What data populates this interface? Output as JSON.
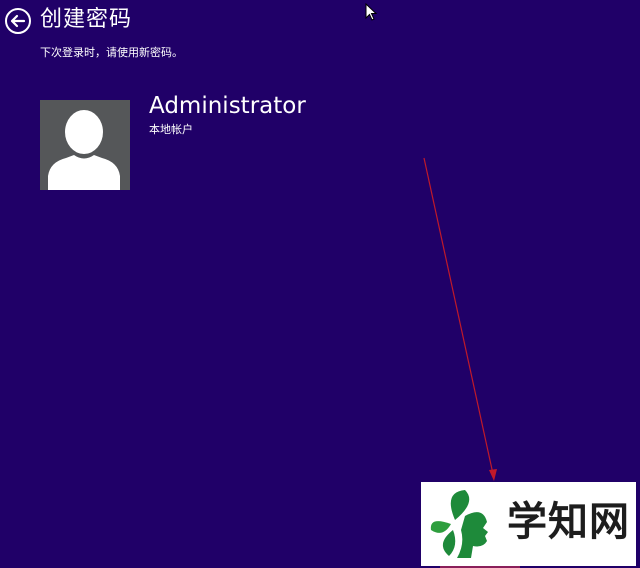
{
  "header": {
    "back_icon": "arrow-left-circle-icon",
    "title": "创建密码"
  },
  "instruction": "下次登录时，请使用新密码。",
  "account": {
    "avatar_icon": "user-silhouette-icon",
    "name": "Administrator",
    "type": "本地帐户"
  },
  "overlay": {
    "cursor_icon": "mouse-pointer-icon",
    "annotation_arrow_color": "#c0192a"
  },
  "watermark": {
    "text": "学知网",
    "logo_icon": "leaf-face-logo-icon",
    "logo_color": "#1e8a3a"
  },
  "colors": {
    "background": "#200068",
    "text": "#ffffff",
    "avatar_bg": "#555759"
  }
}
